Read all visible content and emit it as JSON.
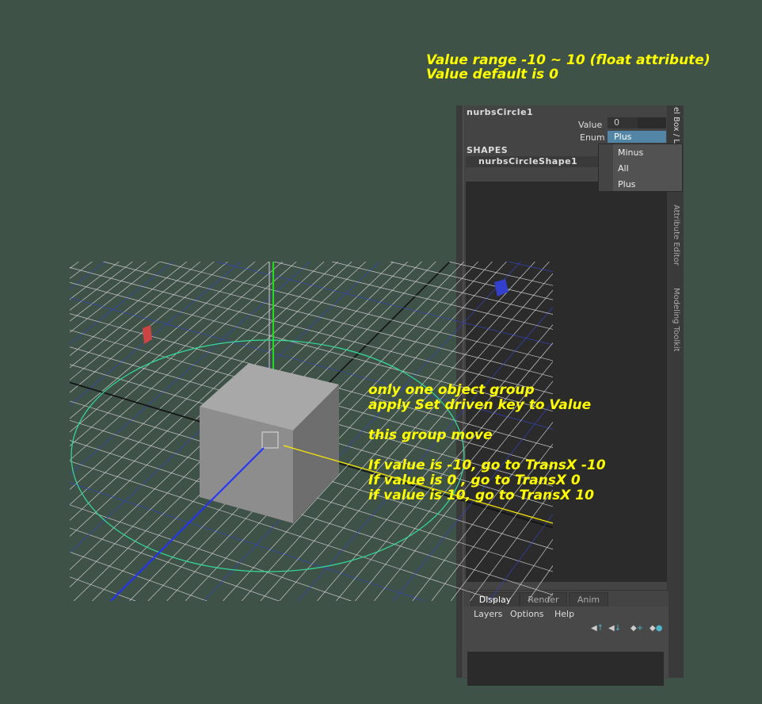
{
  "annotations": {
    "top": "Value range -10 ~ 10 (float attribute)\nValue default is 0",
    "middle": "only one object group\napply Set driven key to Value\n\nthis group move\n\nIf value is -10, go to TransX -10\nIf value is 0 , go to TransX 0\nif value is 10, go to TransX 10"
  },
  "channel_box": {
    "object_name": "nurbsCircle1",
    "attributes": [
      {
        "label": "Value",
        "value": "0"
      },
      {
        "label": "Enum",
        "value": "Plus"
      }
    ],
    "shapes_header": "SHAPES",
    "shape_name": "nurbsCircleShape1",
    "dropdown_options": [
      "Minus",
      "All",
      "Plus"
    ],
    "side_tabs": [
      "el Box / L",
      "Attribute Editor",
      "Modeling Toolkit"
    ]
  },
  "layer_editor": {
    "tabs": [
      "Display",
      "Render",
      "Anim"
    ],
    "menus": [
      "Layers",
      "Options",
      "Help"
    ],
    "icons": [
      "move-layer-up-icon",
      "move-layer-down-icon",
      "new-layer-icon",
      "new-layer-from-selected-icon"
    ]
  },
  "colors": {
    "background": "#3f5247",
    "annotation": "#ffff00",
    "enum_highlight": "#5285a6",
    "circle": "#33dd99",
    "cube": "#8a8a8a"
  }
}
